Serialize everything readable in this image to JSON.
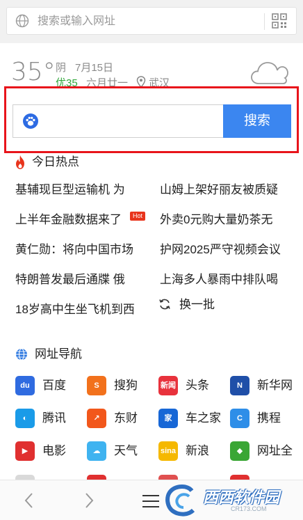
{
  "address_bar": {
    "placeholder": "搜索或输入网址",
    "left_icon": "globe-icon",
    "right_icon": "qr-code-icon"
  },
  "weather": {
    "temperature": "35°",
    "condition": "阴",
    "date": "7月15日",
    "air_quality": "优35",
    "lunar_date": "六月廿一",
    "city": "武汉",
    "icon": "cloud-icon"
  },
  "search": {
    "engine_icon": "baidu-paw-icon",
    "value": "",
    "button_label": "搜索",
    "highlight_color": "#e8141b",
    "button_color": "#3b86f0"
  },
  "hot": {
    "title": "今日热点",
    "badge": "Hot",
    "items_left": [
      "基辅现巨型运输机 为",
      "上半年金融数据来了",
      "黄仁勋：将向中国市场",
      "特朗普发最后通牒 俄",
      "18岁高中生坐飞机到西"
    ],
    "items_right": [
      "山姆上架好丽友被质疑",
      "外卖0元购大量奶茶无",
      "护网2025严守视频会议",
      "上海多人暴雨中排队喝"
    ],
    "refresh_label": "换一批"
  },
  "nav": {
    "title": "网址导航",
    "sites": [
      {
        "label": "百度",
        "icon": "baidu-icon",
        "color": "#2f6be0",
        "glyph": "du"
      },
      {
        "label": "搜狗",
        "icon": "sogou-icon",
        "color": "#f2711c",
        "glyph": "S"
      },
      {
        "label": "头条",
        "icon": "toutiao-icon",
        "color": "#e8323c",
        "glyph": "新闻"
      },
      {
        "label": "新华网",
        "icon": "xinhua-icon",
        "color": "#1f4fa8",
        "glyph": "N"
      },
      {
        "label": "腾讯",
        "icon": "tencent-icon",
        "color": "#1a9be8",
        "glyph": "◐"
      },
      {
        "label": "东财",
        "icon": "eastmoney-icon",
        "color": "#f2571b",
        "glyph": "↗"
      },
      {
        "label": "车之家",
        "icon": "autohome-icon",
        "color": "#1767d6",
        "glyph": "家"
      },
      {
        "label": "携程",
        "icon": "ctrip-icon",
        "color": "#2e8ee8",
        "glyph": "C"
      },
      {
        "label": "电影",
        "icon": "movie-icon",
        "color": "#e03030",
        "glyph": "▶"
      },
      {
        "label": "天气",
        "icon": "weather-icon",
        "color": "#3fb3f0",
        "glyph": "☁"
      },
      {
        "label": "新浪",
        "icon": "sina-icon",
        "color": "#f5b800",
        "glyph": "sina"
      },
      {
        "label": "网址全",
        "icon": "allsites-icon",
        "color": "#3aa635",
        "glyph": "◆"
      }
    ],
    "peek_colors": [
      "#d9d9d9",
      "#e03030",
      "#e05050",
      "#e03030"
    ]
  },
  "bottom": {
    "back_icon": "chevron-left-icon",
    "forward_icon": "chevron-right-icon",
    "menu_icon": "menu-icon",
    "watermark_title": "西西软件园",
    "watermark_sub": "CR173.COM"
  }
}
